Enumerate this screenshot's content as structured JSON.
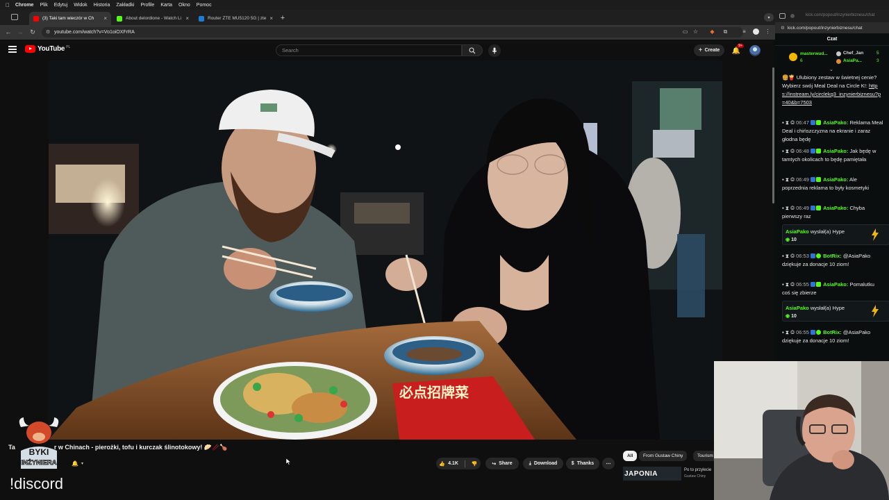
{
  "menubar": {
    "app": "Chrome",
    "items": [
      "Plik",
      "Edytuj",
      "Widok",
      "Historia",
      "Zakładki",
      "Profile",
      "Karta",
      "Okno",
      "Pomoc"
    ]
  },
  "tabs": [
    {
      "title": "(3) Taki tam wieczór w Ch",
      "active": true,
      "favicon_color": "#ff0000"
    },
    {
      "title": "About delordione - Watch Li",
      "active": false,
      "favicon_color": "#53fc18"
    },
    {
      "title": "Router ZTE MU5120 5G | zte",
      "active": false,
      "favicon_color": "#1e7bd6"
    }
  ],
  "address": {
    "url": "youtube.com/watch?v=Vo1oiOXFrRA"
  },
  "youtube": {
    "logo_text": "YouTube",
    "country": "PL",
    "search_placeholder": "Search",
    "create_label": "Create",
    "notification_count": "9+"
  },
  "video": {
    "title_prefix": "Ta",
    "title": "r w Chinach - pierożki, tofu i kurczak ślinotokowy! 🥟🥢🍗",
    "sign_text": "必点招牌菜",
    "channel_badge": [
      "BYKI",
      "INŻYNIERA"
    ]
  },
  "actions": {
    "likes": "4.1K",
    "share": "Share",
    "download": "Download",
    "thanks": "Thanks",
    "more": "⋯"
  },
  "chips": [
    "All",
    "From Gustaw Chiny",
    "Tourism"
  ],
  "recommendation": {
    "thumb_text": "JAPONIA",
    "title": "Po to przylecie",
    "channel": "Gustaw Chiny"
  },
  "overlay_text": "!discord",
  "chat": {
    "top_url": "kick.com/popout/inzynierbiznesu/chat",
    "url": "kick.com/popout/inzynierbiznesu/chat",
    "header": "Czat",
    "leaders": [
      {
        "name": "masterwud...",
        "count": "6"
      },
      {
        "name": "Chef_Jan",
        "count": "5"
      },
      {
        "name": "AsiaPa...",
        "count": "3"
      }
    ],
    "ad_text": "🍔🍟 Ulubiony zestaw w świetnej cenie? Wybierz swój Meal Deal na Circle K!:",
    "ad_link": "https://instream.ly/circlekq3_inzynierbiznesu?p=40&b=7503",
    "messages": [
      {
        "time": "06:47",
        "user": "AsiaPako:",
        "text": "Reklama Meal Deal i chińszczyzna na ekranie i zaraz głodna będę"
      },
      {
        "time": "06:48",
        "user": "AsiaPako:",
        "text": "Jak będę w tamtych okolicach to będę pamiętała"
      },
      {
        "time": "06:49",
        "user": "AsiaPako:",
        "text": "Ale poprzednia reklama to były kosmetyki"
      },
      {
        "time": "06:49",
        "user": "AsiaPako:",
        "text": "Chyba pierwszy raz"
      },
      {
        "time": "06:53",
        "user": "BotRix:",
        "text": "@AsiaPako dziękuje za donacje 10 ziom!"
      },
      {
        "time": "06:55",
        "user": "AsiaPako:",
        "text": "Pomalutku coś się zbierze"
      },
      {
        "time": "06:55",
        "user": "BotRix:",
        "text": "@AsiaPako dziękuje za donacje 10 ziom!"
      }
    ],
    "hype": [
      {
        "user": "AsiaPako",
        "action": "wysłał(a) Hype",
        "amount": "10"
      },
      {
        "user": "AsiaPako",
        "action": "wysłał(a) Hype",
        "amount": "10"
      }
    ]
  },
  "colors": {
    "kick_green": "#53fc18",
    "youtube_red": "#ff0000",
    "background": "#0f0f0f"
  }
}
